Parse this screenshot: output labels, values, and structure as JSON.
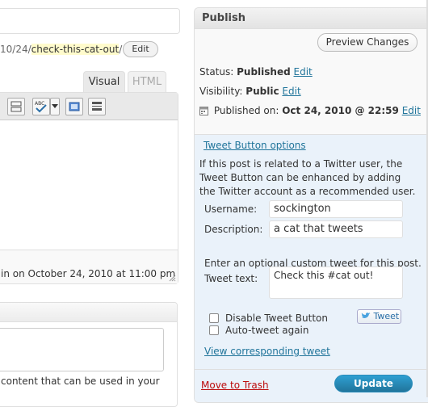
{
  "editor": {
    "permalink_prefix": "10/24/",
    "permalink_slug": "check-this-cat-out",
    "permalink_suffix": "/",
    "edit_slug_label": "Edit",
    "tab_visual": "Visual",
    "tab_html": "HTML",
    "status_text": "in on October 24, 2010 at 11:00 pm",
    "excerpt_hint": "content that can be used in your"
  },
  "publish": {
    "title": "Publish",
    "preview_label": "Preview Changes",
    "status_label": "Status:",
    "status_value": "Published",
    "visibility_label": "Visibility:",
    "visibility_value": "Public",
    "published_on_label": "Published on:",
    "published_on_value": "Oct 24, 2010 @ 22:59",
    "edit_label": "Edit"
  },
  "tweet": {
    "options_link": "Tweet Button options",
    "description": "If this post is related to a Twitter user, the Tweet Button can be enhanced by adding the Twitter account as a recommended user.",
    "username_label": "Username:",
    "username_value": "sockington",
    "description_label": "Description:",
    "description_value": "a cat that tweets",
    "optional_note": "Enter an optional custom tweet for this post.",
    "tweet_text_label": "Tweet text:",
    "tweet_text_value": "Check this #cat out!",
    "disable_label": "Disable Tweet Button",
    "autotweet_label": "Auto-tweet again",
    "tweet_button_label": "Tweet",
    "view_link": "View corresponding tweet"
  },
  "footer": {
    "trash_label": "Move to Trash",
    "update_label": "Update"
  },
  "colors": {
    "link": "#21759b",
    "trash": "#bc0b0b",
    "tweet_panel_bg": "#eaf2fa",
    "update_button": "#21759b"
  }
}
